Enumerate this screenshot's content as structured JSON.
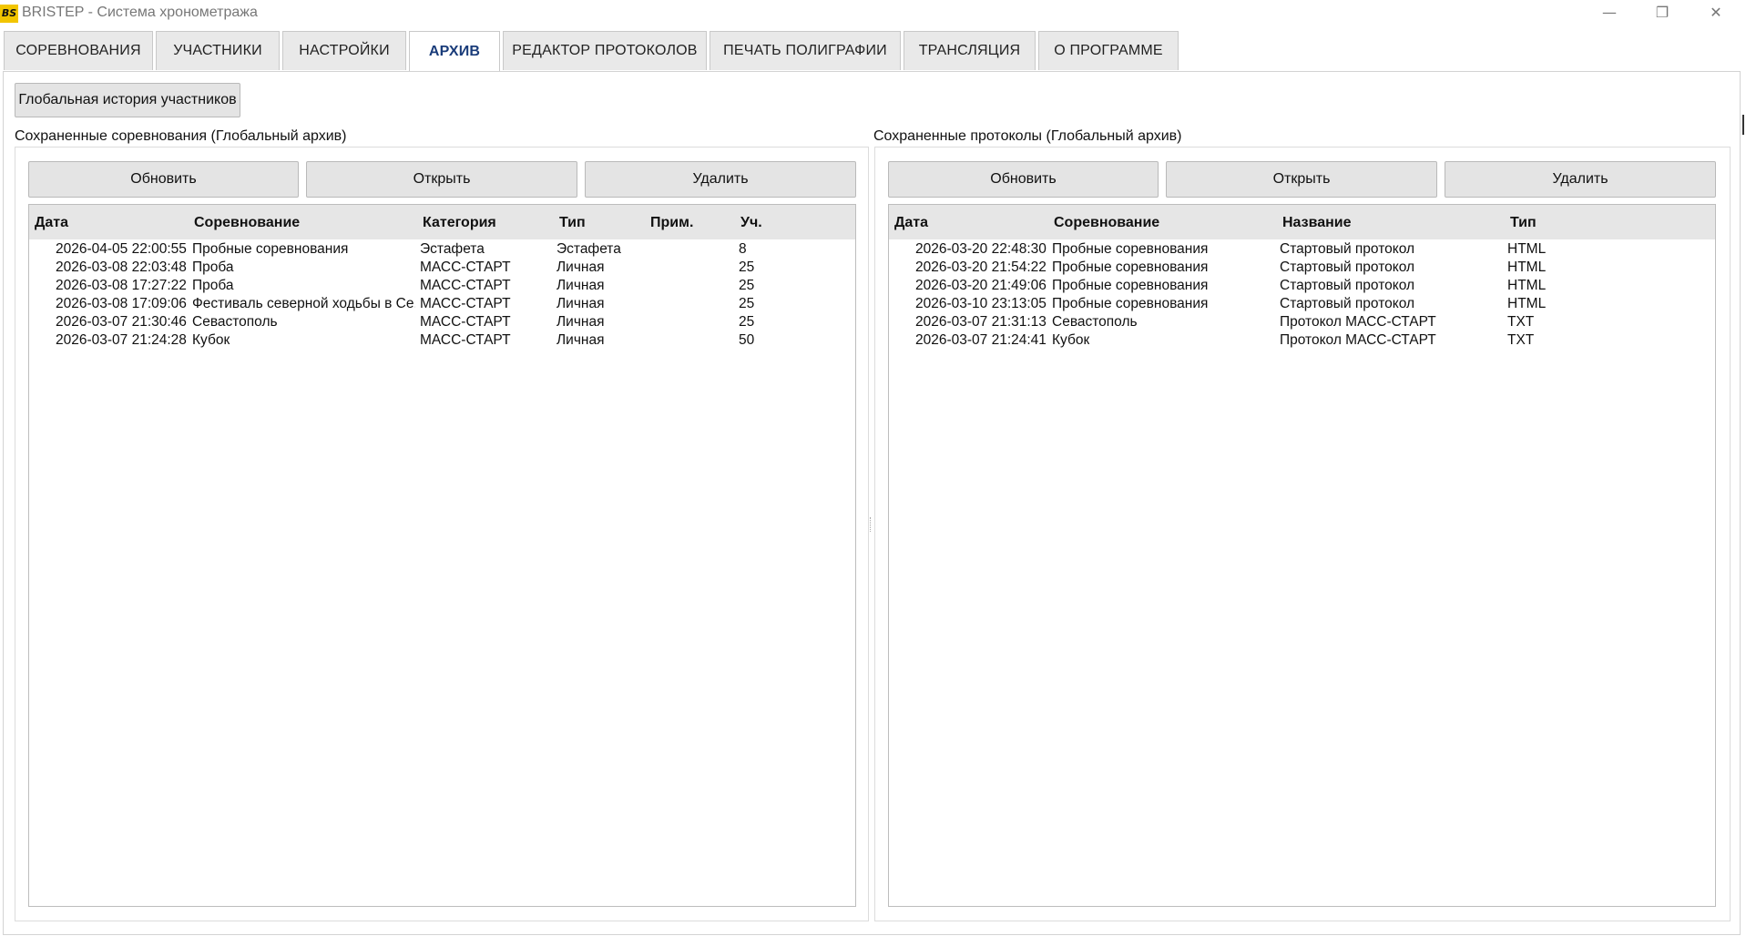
{
  "window": {
    "icon_text": "BS",
    "title": "BRISTEP - Система хронометража",
    "minimize_glyph": "—",
    "maximize_glyph": "❐",
    "close_glyph": "✕"
  },
  "tabs": [
    {
      "label": "СОРЕВНОВАНИЯ"
    },
    {
      "label": "УЧАСТНИКИ"
    },
    {
      "label": "НАСТРОЙКИ"
    },
    {
      "label": "АРХИВ"
    },
    {
      "label": "РЕДАКТОР ПРОТОКОЛОВ"
    },
    {
      "label": "ПЕЧАТЬ ПОЛИГРАФИИ"
    },
    {
      "label": "ТРАНСЛЯЦИЯ"
    },
    {
      "label": "О ПРОГРАММЕ"
    }
  ],
  "active_tab": "АРХИВ",
  "global_history_button": "Глобальная история участников",
  "competitions_panel": {
    "title": "Сохраненные соревнования (Глобальный архив)",
    "refresh_label": "Обновить",
    "open_label": "Открыть",
    "delete_label": "Удалить",
    "columns": [
      "Дата",
      "Соревнование",
      "Категория",
      "Тип",
      "Прим.",
      "Уч."
    ],
    "rows": [
      [
        "2026-04-05 22:00:55",
        "Пробные соревнования",
        "Эстафета",
        "Эстафета",
        "",
        "8"
      ],
      [
        "2026-03-08 22:03:48",
        "Проба",
        "МАСС-СТАРТ",
        "Личная",
        "",
        "25"
      ],
      [
        "2026-03-08 17:27:22",
        "Проба",
        "МАСС-СТАРТ",
        "Личная",
        "",
        "25"
      ],
      [
        "2026-03-08 17:09:06",
        "Фестиваль северной ходьбы в Се...",
        "МАСС-СТАРТ",
        "Личная",
        "",
        "25"
      ],
      [
        "2026-03-07 21:30:46",
        "Севастополь",
        "МАСС-СТАРТ",
        "Личная",
        "",
        "25"
      ],
      [
        "2026-03-07 21:24:28",
        "Кубок",
        "МАСС-СТАРТ",
        "Личная",
        "",
        "50"
      ]
    ]
  },
  "protocols_panel": {
    "title": "Сохраненные протоколы (Глобальный архив)",
    "refresh_label": "Обновить",
    "open_label": "Открыть",
    "delete_label": "Удалить",
    "columns": [
      "Дата",
      "Соревнование",
      "Название",
      "Тип"
    ],
    "rows": [
      [
        "2026-03-20 22:48:30",
        "Пробные соревнования",
        "Стартовый протокол",
        "HTML"
      ],
      [
        "2026-03-20 21:54:22",
        "Пробные соревнования",
        "Стартовый протокол",
        "HTML"
      ],
      [
        "2026-03-20 21:49:06",
        "Пробные соревнования",
        "Стартовый протокол",
        "HTML"
      ],
      [
        "2026-03-10 23:13:05",
        "Пробные соревнования",
        "Стартовый протокол",
        "HTML"
      ],
      [
        "2026-03-07 21:31:13",
        "Севастополь",
        "Протокол МАСС-СТАРТ",
        "TXT"
      ],
      [
        "2026-03-07 21:24:41",
        "Кубок",
        "Протокол МАСС-СТАРТ",
        "TXT"
      ]
    ]
  }
}
